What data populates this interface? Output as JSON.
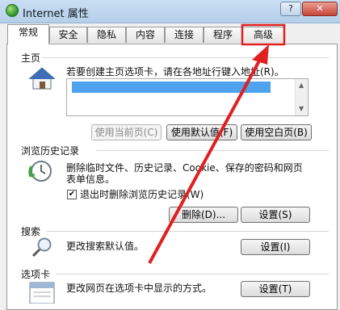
{
  "window": {
    "title": "Internet 属性",
    "help_label": "?",
    "close_label": "✕"
  },
  "tabs": [
    {
      "label": "常规"
    },
    {
      "label": "安全"
    },
    {
      "label": "隐私"
    },
    {
      "label": "内容"
    },
    {
      "label": "连接"
    },
    {
      "label": "程序"
    },
    {
      "label": "高级"
    }
  ],
  "homepage": {
    "section_title": "主页",
    "description": "若要创建主页选项卡，请在各地址行键入地址(R)。",
    "url_redacted": true,
    "use_current_label": "使用当前页(C)",
    "use_default_label": "使用默认值(F)",
    "use_blank_label": "使用空白页(B)"
  },
  "history": {
    "section_title": "浏览历史记录",
    "description_line1": "删除临时文件、历史记录、Cookie、保存的密码和网页",
    "description_line2": "表单信息。",
    "delete_on_exit_label": "退出时删除浏览历史记录(W)",
    "delete_on_exit_checked": true,
    "delete_label": "删除(D)...",
    "settings_label": "设置(S)"
  },
  "search": {
    "section_title": "搜索",
    "description": "更改搜索默认值。",
    "settings_label": "设置(I)"
  },
  "tabs_section": {
    "section_title": "选项卡",
    "description": "更改网页在选项卡中显示的方式。",
    "settings_label": "设置(T)"
  },
  "annotation": {
    "color": "#e02020",
    "highlighted_tab": "高级"
  }
}
